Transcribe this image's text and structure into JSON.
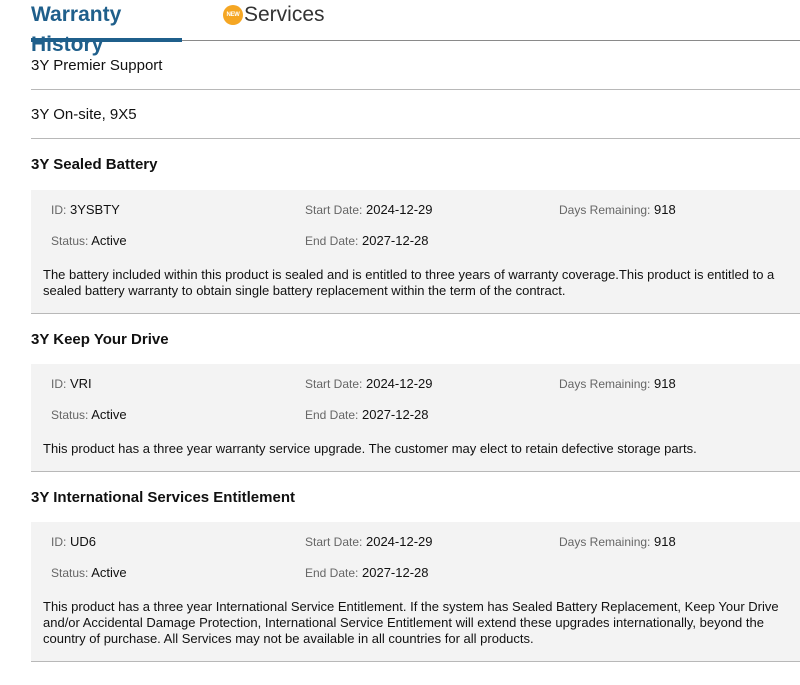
{
  "tabs": {
    "warranty_history": "Warranty History",
    "services_badge": "NEW",
    "services": "Services"
  },
  "rows": [
    {
      "label": "3Y Premier Support"
    },
    {
      "label": "3Y On-site, 9X5"
    }
  ],
  "labels": {
    "id": "ID:",
    "status": "Status:",
    "start_date": "Start Date:",
    "end_date": "End Date:",
    "days_remaining": "Days Remaining:"
  },
  "sections": [
    {
      "title": "3Y Sealed Battery",
      "id": "3YSBTY",
      "status": "Active",
      "start_date": "2024-12-29",
      "end_date": "2027-12-28",
      "days_remaining": "918",
      "description": "The battery included within this product is sealed and is entitled to three years of warranty coverage.This product is entitled to a sealed battery warranty to obtain single battery replacement within the term of the contract."
    },
    {
      "title": "3Y Keep Your Drive",
      "id": "VRI",
      "status": "Active",
      "start_date": "2024-12-29",
      "end_date": "2027-12-28",
      "days_remaining": "918",
      "description": "This product has a three year warranty service upgrade. The customer may elect to retain defective storage parts."
    },
    {
      "title": "3Y International Services Entitlement",
      "id": "UD6",
      "status": "Active",
      "start_date": "2024-12-29",
      "end_date": "2027-12-28",
      "days_remaining": "918",
      "description": "This product has a three year International Service Entitlement. If the system has Sealed Battery Replacement, Keep Your Drive and/or Accidental Damage Protection, International Service Entitlement will extend these upgrades internationally, beyond the country of purchase. All Services may not be available in all countries for all products."
    }
  ],
  "colors": {
    "active_tab": "#1f5f8b",
    "badge": "#f5a623",
    "panel_bg": "#f3f3f3"
  }
}
